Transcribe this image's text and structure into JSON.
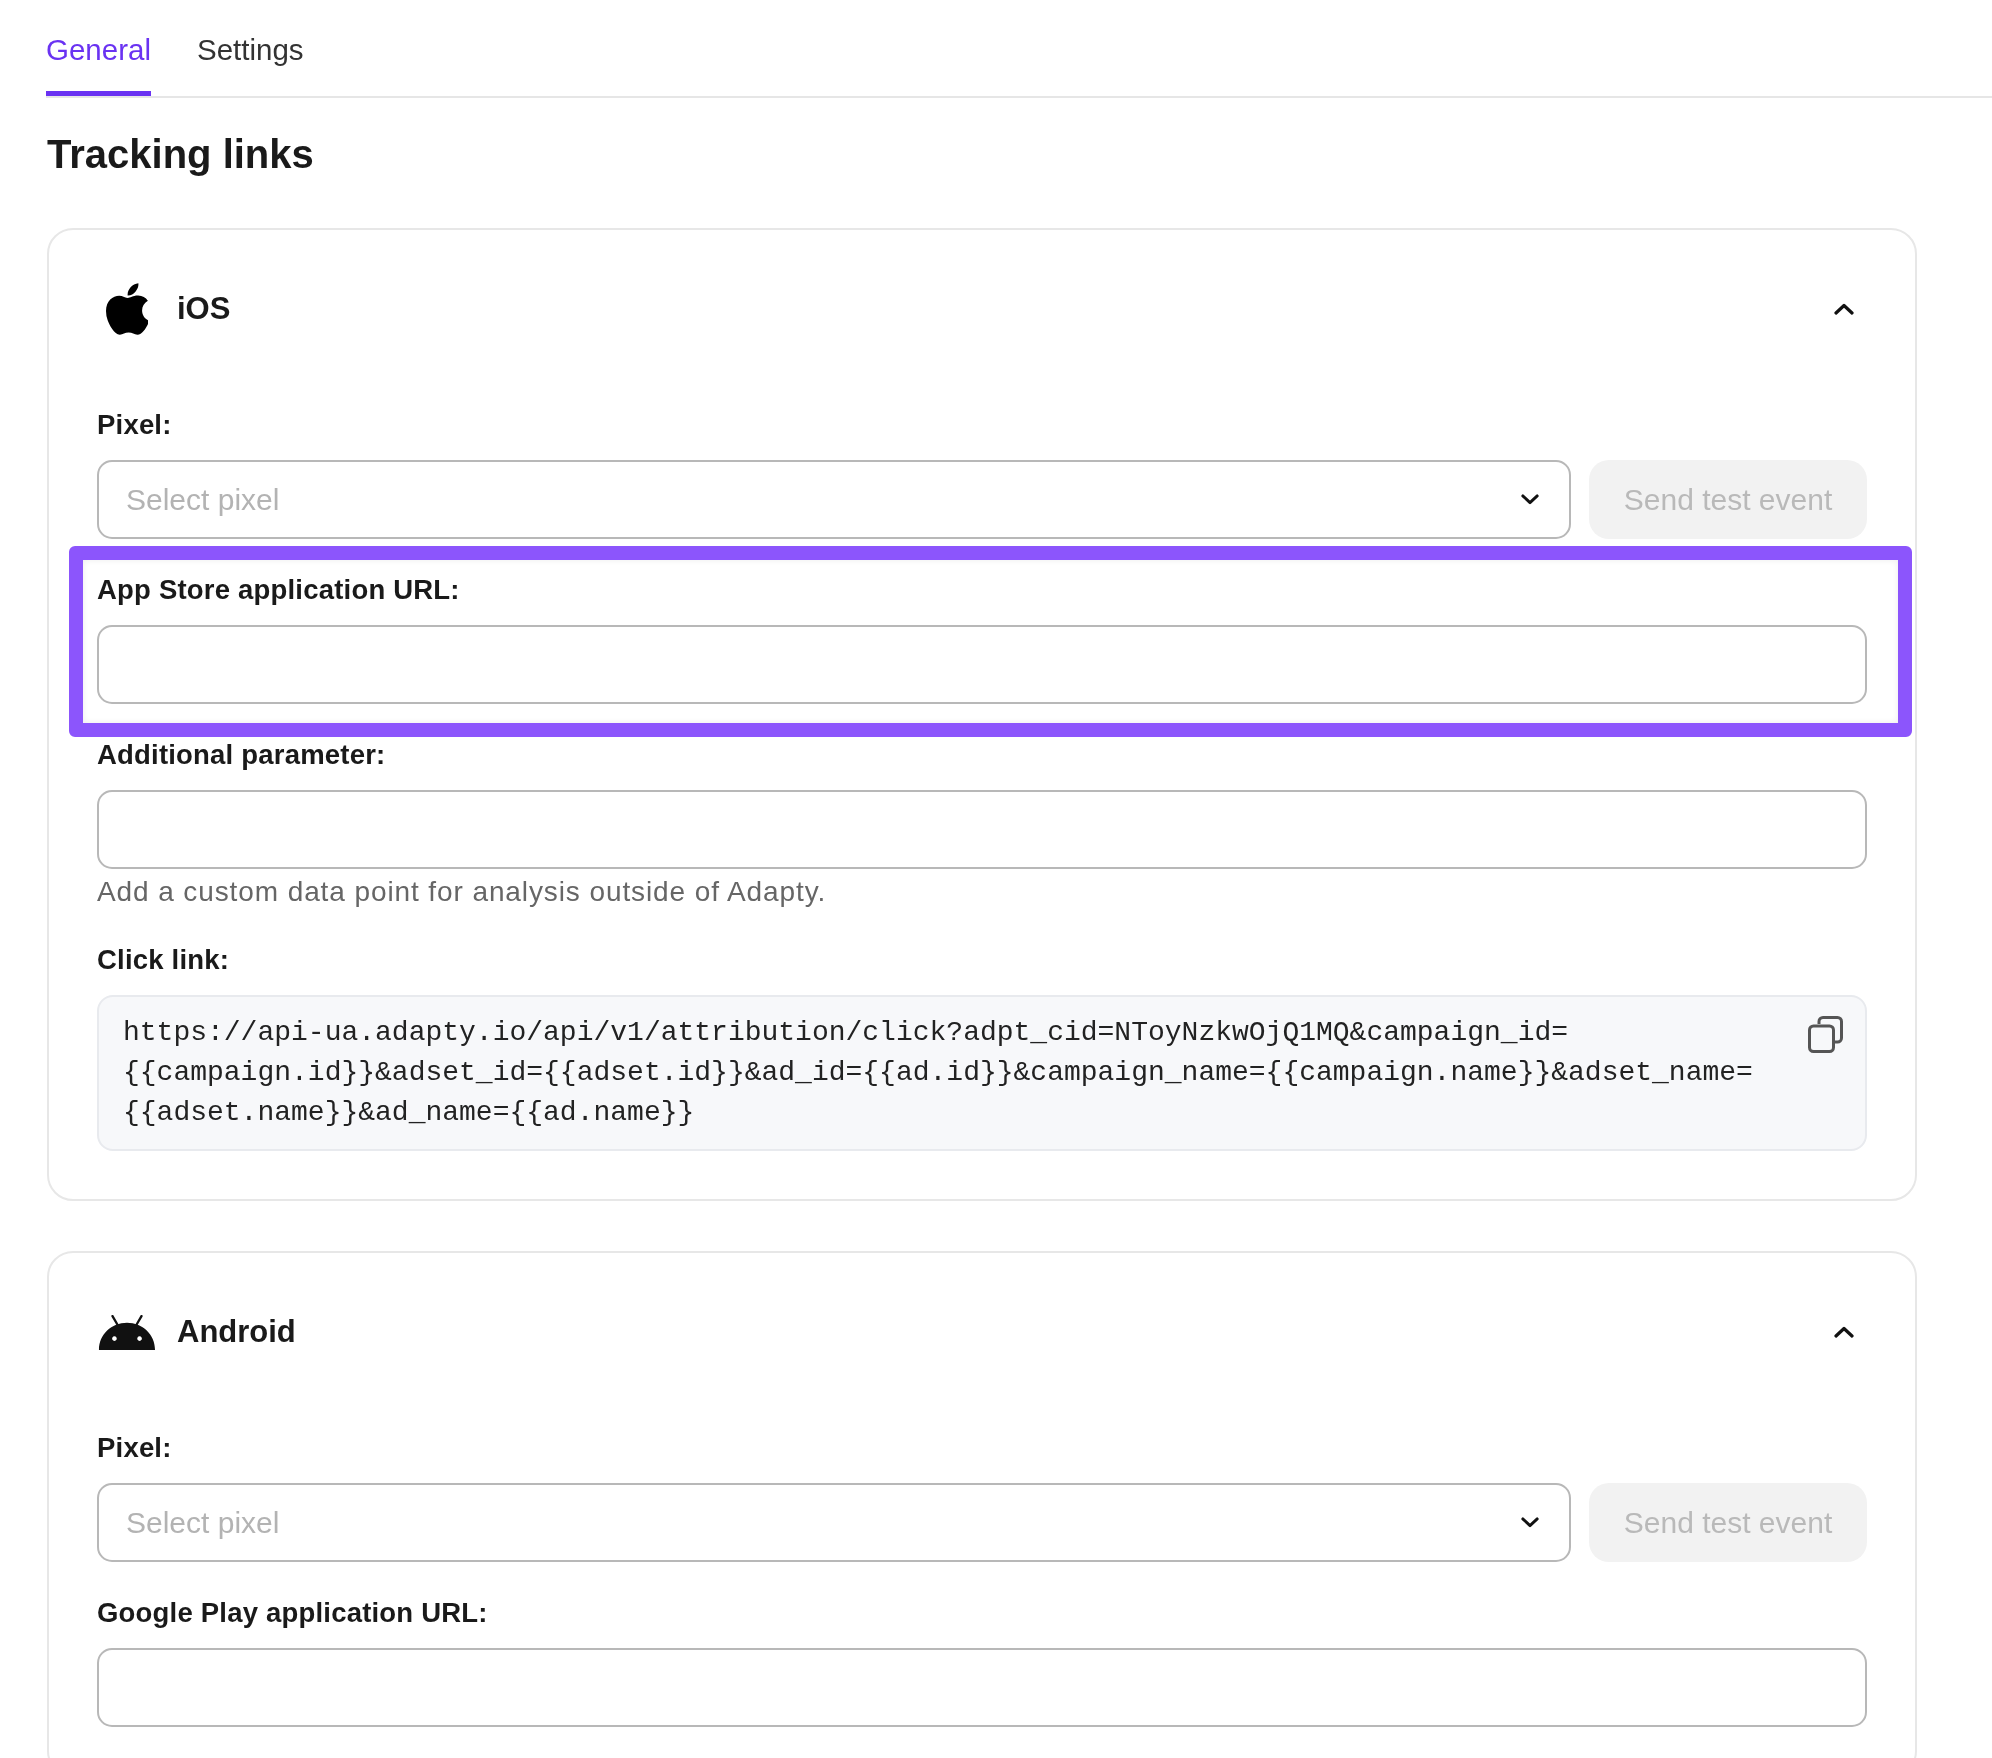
{
  "tabs": [
    {
      "label": "General",
      "selected": true
    },
    {
      "label": "Settings",
      "selected": false
    }
  ],
  "title": "Tracking links",
  "platforms": [
    {
      "kind": "ios",
      "name": "iOS",
      "expanded": true,
      "fields": [
        {
          "kind": "select",
          "label": "Pixel:",
          "placeholder": "Select pixel",
          "button": {
            "label": "Send test event",
            "disabled": true
          },
          "highlighted": false
        },
        {
          "kind": "text",
          "label": "App Store application URL:",
          "highlighted": true
        },
        {
          "kind": "text",
          "label": "Additional parameter:",
          "help": "Add a custom data point for analysis outside of Adapty.",
          "highlighted": false
        },
        {
          "kind": "code",
          "label": "Click link:",
          "lines": [
            "https://api-ua.adapty.io/api/v1/attribution/click?adpt_cid=NToyNzkwOjQ1MQ&campaign_id=",
            "{{campaign.id}}&adset_id={{adset.id}}&ad_id={{ad.id}}&campaign_name={{campaign.name}}&adset_name=",
            "{{adset.name}}&ad_name={{ad.name}}"
          ],
          "highlighted": false
        }
      ]
    },
    {
      "kind": "android",
      "name": "Android",
      "expanded": true,
      "fields": [
        {
          "kind": "select",
          "label": "Pixel:",
          "placeholder": "Select pixel",
          "button": {
            "label": "Send test event",
            "disabled": true
          },
          "highlighted": false
        },
        {
          "kind": "text",
          "label": "Google Play application URL:",
          "highlighted": false
        }
      ]
    }
  ]
}
